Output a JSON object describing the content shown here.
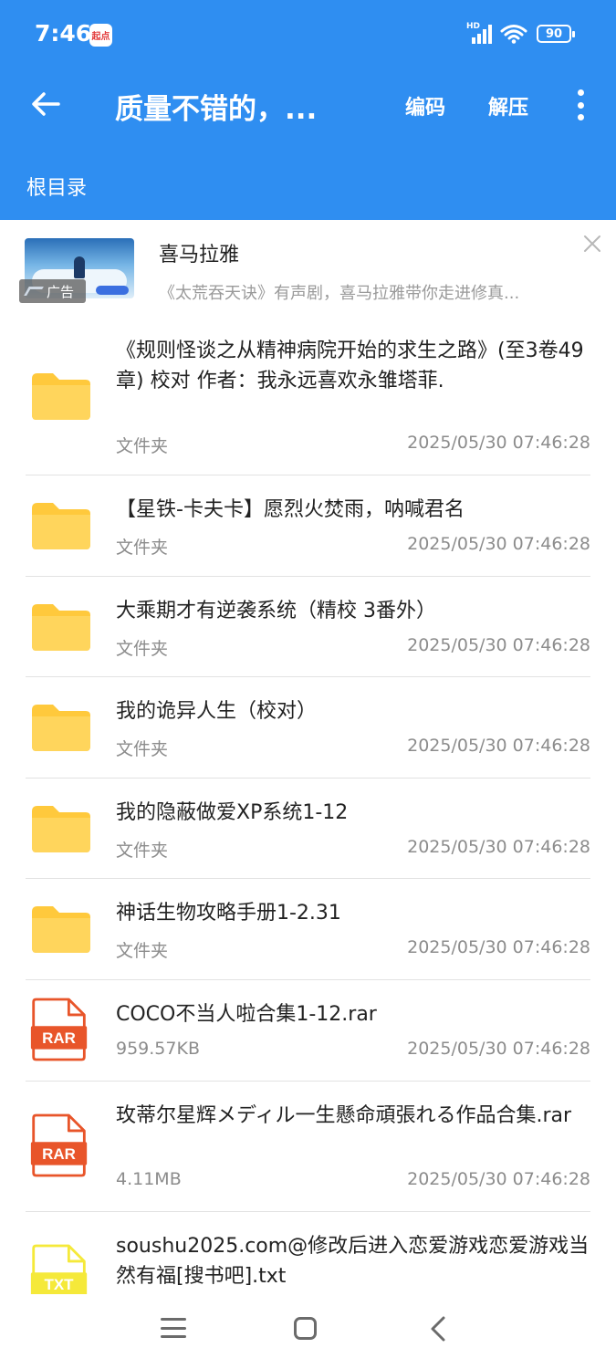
{
  "status_bar": {
    "time": "7:46",
    "notification_app": "起点",
    "network": "HD",
    "battery": "90"
  },
  "toolbar": {
    "title": "质量不错的，...",
    "encode_label": "编码",
    "extract_label": "解压"
  },
  "breadcrumb": {
    "root_label": "根目录"
  },
  "ad": {
    "title": "喜马拉雅",
    "description": "《太荒吞天诀》有声剧，喜马拉雅带你走进修真...",
    "tag": "广告"
  },
  "files": [
    {
      "type": "folder",
      "name": "《规则怪谈之从精神病院开始的求生之路》(至3卷49章) 校对 作者：我永远喜欢永雏塔菲.",
      "kind": "文件夹",
      "date": "2025/05/30 07:46:28"
    },
    {
      "type": "folder",
      "name": "【星铁-卡夫卡】愿烈火焚雨，呐喊君名",
      "kind": "文件夹",
      "date": "2025/05/30 07:46:28"
    },
    {
      "type": "folder",
      "name": "大乘期才有逆袭系统（精校 3番外）",
      "kind": "文件夹",
      "date": "2025/05/30 07:46:28"
    },
    {
      "type": "folder",
      "name": "我的诡异人生（校对）",
      "kind": "文件夹",
      "date": "2025/05/30 07:46:28"
    },
    {
      "type": "folder",
      "name": "我的隐蔽做爱XP系统1-12",
      "kind": "文件夹",
      "date": "2025/05/30 07:46:28"
    },
    {
      "type": "folder",
      "name": "神话生物攻略手册1-2.31",
      "kind": "文件夹",
      "date": "2025/05/30 07:46:28"
    },
    {
      "type": "rar",
      "badge": "RAR",
      "name": "COCO不当人啦合集1-12.rar",
      "size": "959.57KB",
      "date": "2025/05/30 07:46:28"
    },
    {
      "type": "rar",
      "badge": "RAR",
      "name": "玫蒂尔星辉メディル一生懸命頑張れる作品合集.rar",
      "size": "4.11MB",
      "date": "2025/05/30 07:46:28"
    },
    {
      "type": "txt",
      "badge": "TXT",
      "name": "soushu2025.com@修改后进入恋爱游戏恋爱游戏当然有福[搜书吧].txt"
    }
  ],
  "icons": {
    "back": "arrow-left-icon",
    "more": "more-vertical-icon",
    "close": "close-icon",
    "folder": "folder-icon",
    "rar": "rar-file-icon",
    "txt": "txt-file-icon"
  },
  "colors": {
    "appbar": "#2f8ef1",
    "folder": "#ffc93c",
    "rar": "#e8552a",
    "txt": "#f5e93a"
  }
}
